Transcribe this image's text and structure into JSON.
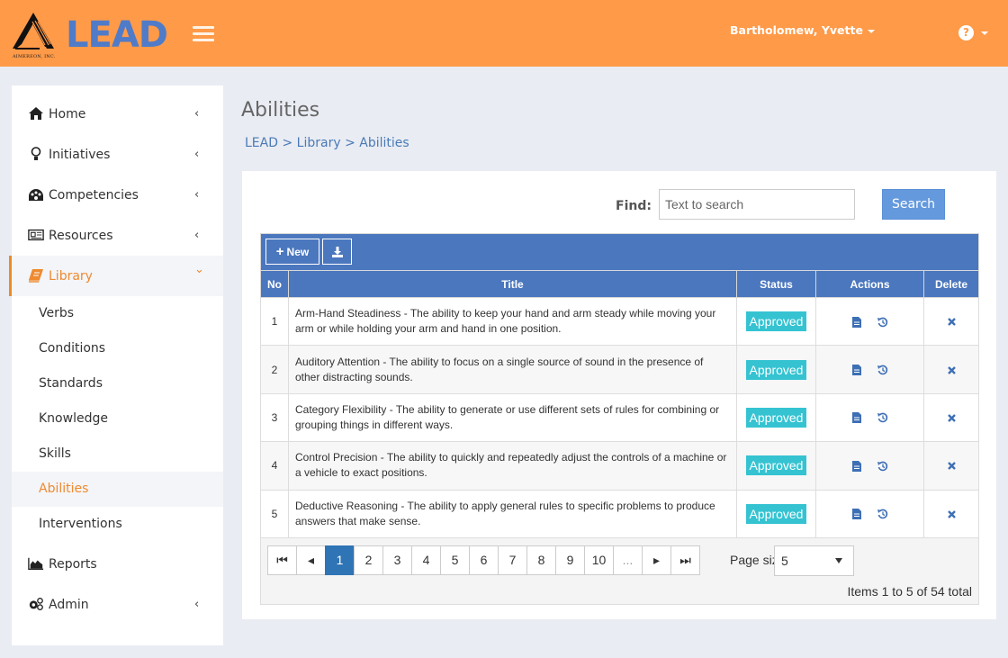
{
  "header": {
    "company": "AIMEREON, INC.",
    "app_name": "LEAD",
    "user_name": "Bartholomew, Yvette",
    "help_icon": "question-circle-icon",
    "brand_color": "#ff9a48",
    "logo_color": "#4f7bc8"
  },
  "sidebar": {
    "items": [
      {
        "label": "Home",
        "icon": "home-icon",
        "chevron": "‹"
      },
      {
        "label": "Initiatives",
        "icon": "lightbulb-icon",
        "chevron": "‹"
      },
      {
        "label": "Competencies",
        "icon": "dashboard-icon",
        "chevron": "‹"
      },
      {
        "label": "Resources",
        "icon": "newspaper-icon",
        "chevron": "‹"
      },
      {
        "label": "Library",
        "icon": "book-icon",
        "chevron": "⌄"
      },
      {
        "label": "Reports",
        "icon": "area-chart-icon"
      },
      {
        "label": "Admin",
        "icon": "cogs-icon",
        "chevron": "‹"
      }
    ],
    "library_sub": [
      "Verbs",
      "Conditions",
      "Standards",
      "Knowledge",
      "Skills",
      "Abilities",
      "Interventions"
    ],
    "active_item": "Library",
    "active_sub": "Abilities",
    "active_color": "#ee8a30"
  },
  "page": {
    "title": "Abilities",
    "breadcrumb": [
      "LEAD",
      "Library",
      "Abilities"
    ],
    "breadcrumb_sep": ">"
  },
  "search": {
    "label": "Find:",
    "placeholder": "Text to search",
    "value": "",
    "button": "Search"
  },
  "grid": {
    "toolbar": {
      "new_label": "New",
      "new_icon": "plus-icon",
      "export_icon": "download-icon"
    },
    "columns": [
      "No",
      "Title",
      "Status",
      "Actions",
      "Delete"
    ],
    "rows": [
      {
        "no": "1",
        "title": "Arm-Hand Steadiness - The ability to keep your hand and arm steady while moving your arm or while holding your arm and hand in one position.",
        "status": "Approved"
      },
      {
        "no": "2",
        "title": "Auditory Attention - The ability to focus on a single source of sound in the presence of other distracting sounds.",
        "status": "Approved"
      },
      {
        "no": "3",
        "title": "Category Flexibility - The ability to generate or use different sets of rules for combining or grouping things in different ways.",
        "status": "Approved"
      },
      {
        "no": "4",
        "title": "Control Precision - The ability to quickly and repeatedly adjust the controls of a machine or a vehicle to exact positions.",
        "status": "Approved"
      },
      {
        "no": "5",
        "title": "Deductive Reasoning - The ability to apply general rules to specific problems to produce answers that make sense.",
        "status": "Approved"
      }
    ],
    "header_color": "#4b77be",
    "status_color": "#35c3d2"
  },
  "pager": {
    "first": "⏮",
    "prev": "◂",
    "pages": [
      "1",
      "2",
      "3",
      "4",
      "5",
      "6",
      "7",
      "8",
      "9",
      "10",
      "..."
    ],
    "current": "1",
    "next": "▸",
    "last": "⏭",
    "page_size_label": "Page size:",
    "page_size": "5",
    "items_info": "Items 1 to 5 of 54 total"
  }
}
